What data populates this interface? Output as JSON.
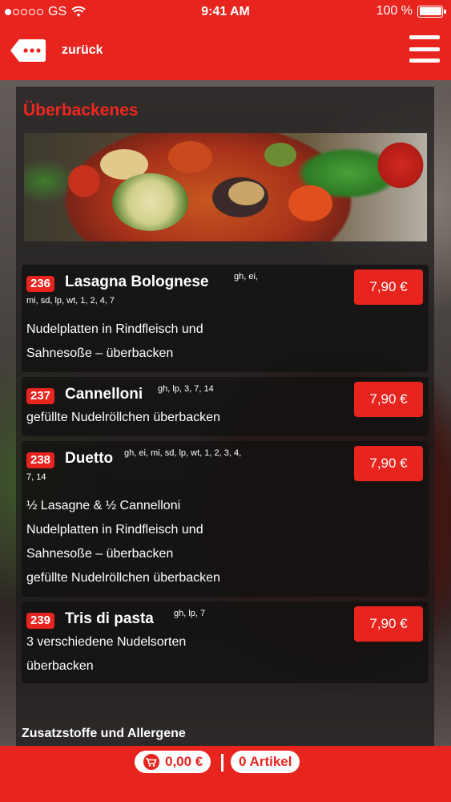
{
  "status_bar": {
    "carrier": "GS",
    "time": "9:41 AM",
    "battery": "100 %"
  },
  "header": {
    "back_label": "zurück"
  },
  "section": {
    "title": "Überbackenes"
  },
  "items": [
    {
      "number": "236",
      "name": "Lasagna Bolognese",
      "allergens_line1": "gh, ei,",
      "allergens_line2": "mi, sd, lp, wt, 1, 2, 4, 7",
      "desc": [
        "Nudelplatten in Rindfleisch und",
        "Sahnesoße – überbacken"
      ],
      "price": "7,90 €"
    },
    {
      "number": "237",
      "name": "Cannelloni",
      "allergens_line1": "gh, lp, 3, 7, 14",
      "desc": [
        "gefüllte Nudelröllchen überbacken"
      ],
      "price": "7,90 €"
    },
    {
      "number": "238",
      "name": "Duetto",
      "allergens_line1": "gh, ei, mi, sd, lp, wt, 1, 2, 3, 4,",
      "allergens_line2": "7, 14",
      "desc": [
        "½ Lasagne & ½ Cannelloni",
        "Nudelplatten in Rindfleisch und",
        "Sahnesoße – überbacken",
        "gefüllte Nudelröllchen überbacken"
      ],
      "price": "7,90 €"
    },
    {
      "number": "239",
      "name": "Tris di pasta",
      "allergens_line1": "gh, lp, 7",
      "desc": [
        "3 verschiedene Nudelsorten",
        "überbacken"
      ],
      "price": "7,90 €"
    }
  ],
  "footer_link": "Zusatzstoffe und Allergene",
  "cart": {
    "total": "0,00 €",
    "count": "0 Artikel"
  },
  "colors": {
    "accent": "#e8241e",
    "panel": "#1c1a1a"
  }
}
